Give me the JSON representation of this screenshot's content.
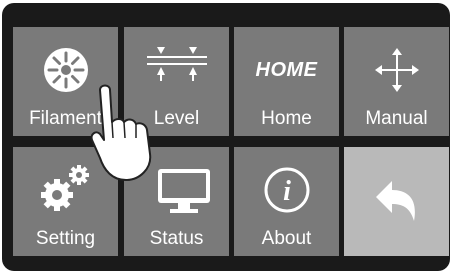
{
  "menu": {
    "tiles": [
      {
        "label": "Filament",
        "icon": "filament-icon"
      },
      {
        "label": "Level",
        "icon": "level-icon"
      },
      {
        "label": "Home",
        "icon": "home-icon",
        "icon_text": "HOME"
      },
      {
        "label": "Manual",
        "icon": "move-arrows-icon"
      },
      {
        "label": "Setting",
        "icon": "gears-icon"
      },
      {
        "label": "Status",
        "icon": "monitor-icon"
      },
      {
        "label": "About",
        "icon": "info-icon",
        "icon_text": "i"
      },
      {
        "label": "",
        "icon": "back-arrow-icon"
      }
    ]
  },
  "colors": {
    "bezel": "#1a1a1a",
    "tile": "#7a7a7a",
    "back_tile": "#b9b9b9",
    "icon": "#ffffff"
  },
  "overlay": {
    "icon": "pointing-hand-icon"
  }
}
